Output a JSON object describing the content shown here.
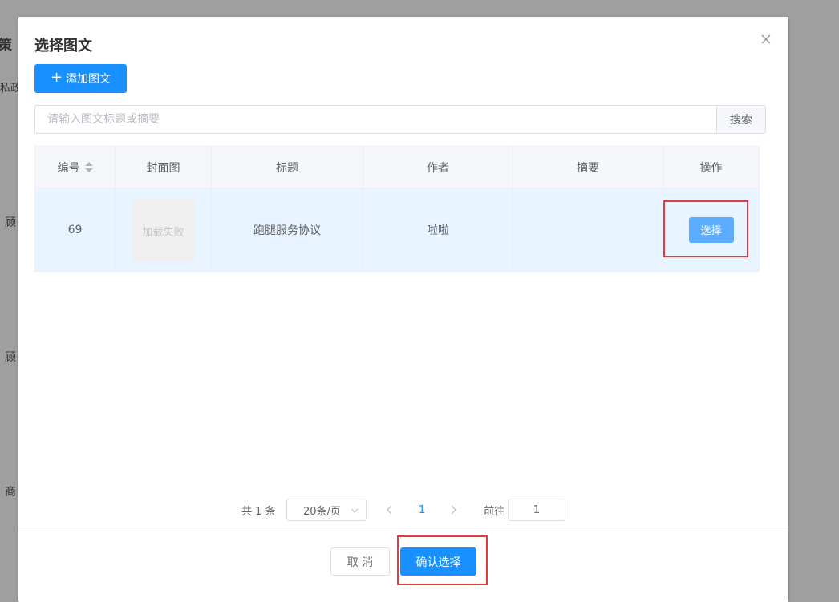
{
  "background": {
    "title_fragment": "策",
    "line1": "私政",
    "line2": "顾",
    "line3": "顾",
    "line4": "商"
  },
  "dialog": {
    "title": "选择图文",
    "add_button": "添加图文",
    "search": {
      "placeholder": "请输入图文标题或摘要",
      "value": "",
      "button": "搜索"
    },
    "table": {
      "columns": [
        "编号",
        "封面图",
        "标题",
        "作者",
        "摘要",
        "操作"
      ],
      "rows": [
        {
          "id": "69",
          "cover": "加载失败",
          "title": "跑腿服务协议",
          "author": "啦啦",
          "summary": "",
          "action": "选择"
        }
      ]
    },
    "pagination": {
      "total": "共 1 条",
      "page_size": "20条/页",
      "current_page": "1",
      "goto_label": "前往",
      "goto_value": "1"
    },
    "footer": {
      "cancel": "取 消",
      "confirm": "确认选择"
    }
  },
  "colors": {
    "primary": "#1890ff",
    "select_button": "#5cadff",
    "row_highlight": "#e8f4ff",
    "annotation_box": "#e5393b"
  },
  "icons": {
    "close": "close-icon",
    "plus": "plus-icon",
    "sort": "sort-icon",
    "chevron_down": "chevron-down-icon",
    "prev": "chevron-left-icon",
    "next": "chevron-right-icon"
  }
}
